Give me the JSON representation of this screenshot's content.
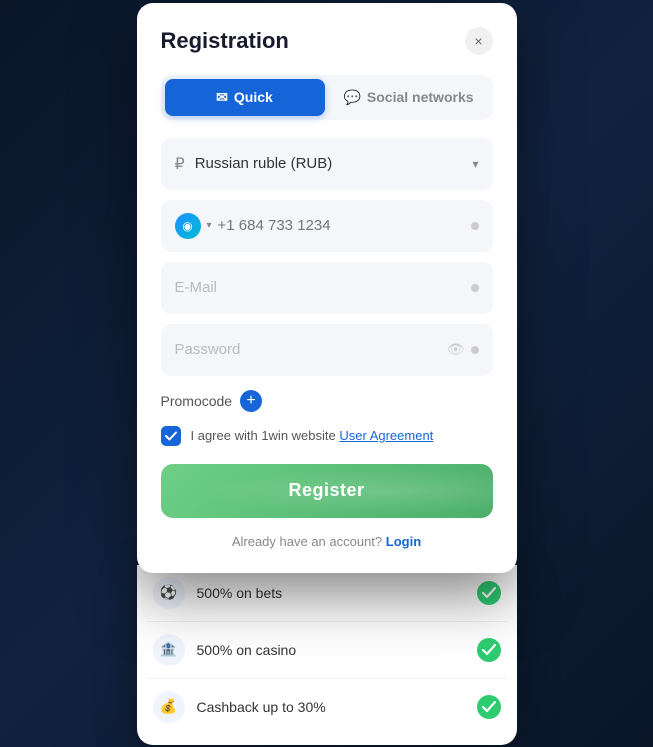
{
  "modal": {
    "title": "Registration",
    "close_label": "×"
  },
  "tabs": [
    {
      "id": "quick",
      "label": "Quick",
      "icon": "✉",
      "active": true
    },
    {
      "id": "social",
      "label": "Social networks",
      "icon": "💬",
      "active": false
    }
  ],
  "currency": {
    "symbol": "₽",
    "label": "Russian ruble (RUB)"
  },
  "phone": {
    "placeholder": "+1 684 733 1234",
    "flag_icon": "◉"
  },
  "email": {
    "placeholder": "E-Mail"
  },
  "password": {
    "placeholder": "Password"
  },
  "promocode": {
    "label": "Promocode",
    "plus_label": "+"
  },
  "agreement": {
    "text": "I agree with 1win website ",
    "link_text": "User Agreement"
  },
  "register_btn": {
    "label": "Register"
  },
  "login_row": {
    "text": "Already have an account?",
    "link": "Login"
  },
  "bonus_items": [
    {
      "icon": "⚽",
      "text": "500% on bets"
    },
    {
      "icon": "🏦",
      "text": "500% on casino"
    },
    {
      "icon": "💰",
      "text": "Cashback up to 30%"
    }
  ]
}
